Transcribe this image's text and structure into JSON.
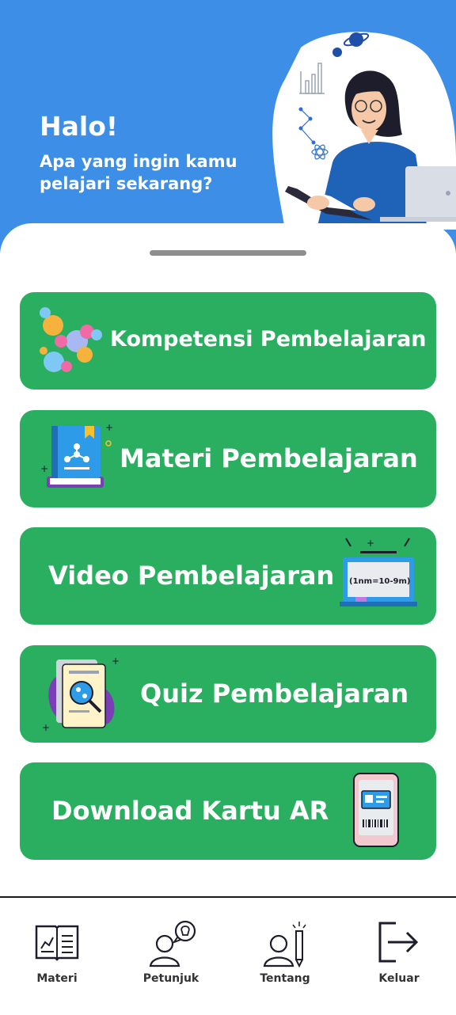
{
  "header": {
    "greeting": "Halo!",
    "subtitle": "Apa yang ingin kamu pelajari sekarang?"
  },
  "menu": [
    {
      "label": "Kompetensi  Pembelajaran",
      "icon": "molecules-icon"
    },
    {
      "label": "Materi Pembelajaran",
      "icon": "science-book-icon"
    },
    {
      "label": "Video Pembelajaran",
      "icon": "blackboard-icon",
      "board_text": "(1nm=10-9m)"
    },
    {
      "label": "Quiz Pembelajaran",
      "icon": "quiz-document-icon"
    },
    {
      "label": "Download Kartu AR",
      "icon": "ar-card-phone-icon"
    }
  ],
  "nav": [
    {
      "label": "Materi",
      "icon": "book-chart-icon"
    },
    {
      "label": "Petunjuk",
      "icon": "person-idea-icon"
    },
    {
      "label": "Tentang",
      "icon": "person-pencil-icon"
    },
    {
      "label": "Keluar",
      "icon": "logout-icon"
    }
  ],
  "colors": {
    "header_blue": "#3d8ee6",
    "card_green": "#2aae5f",
    "text_white": "#ffffff"
  }
}
